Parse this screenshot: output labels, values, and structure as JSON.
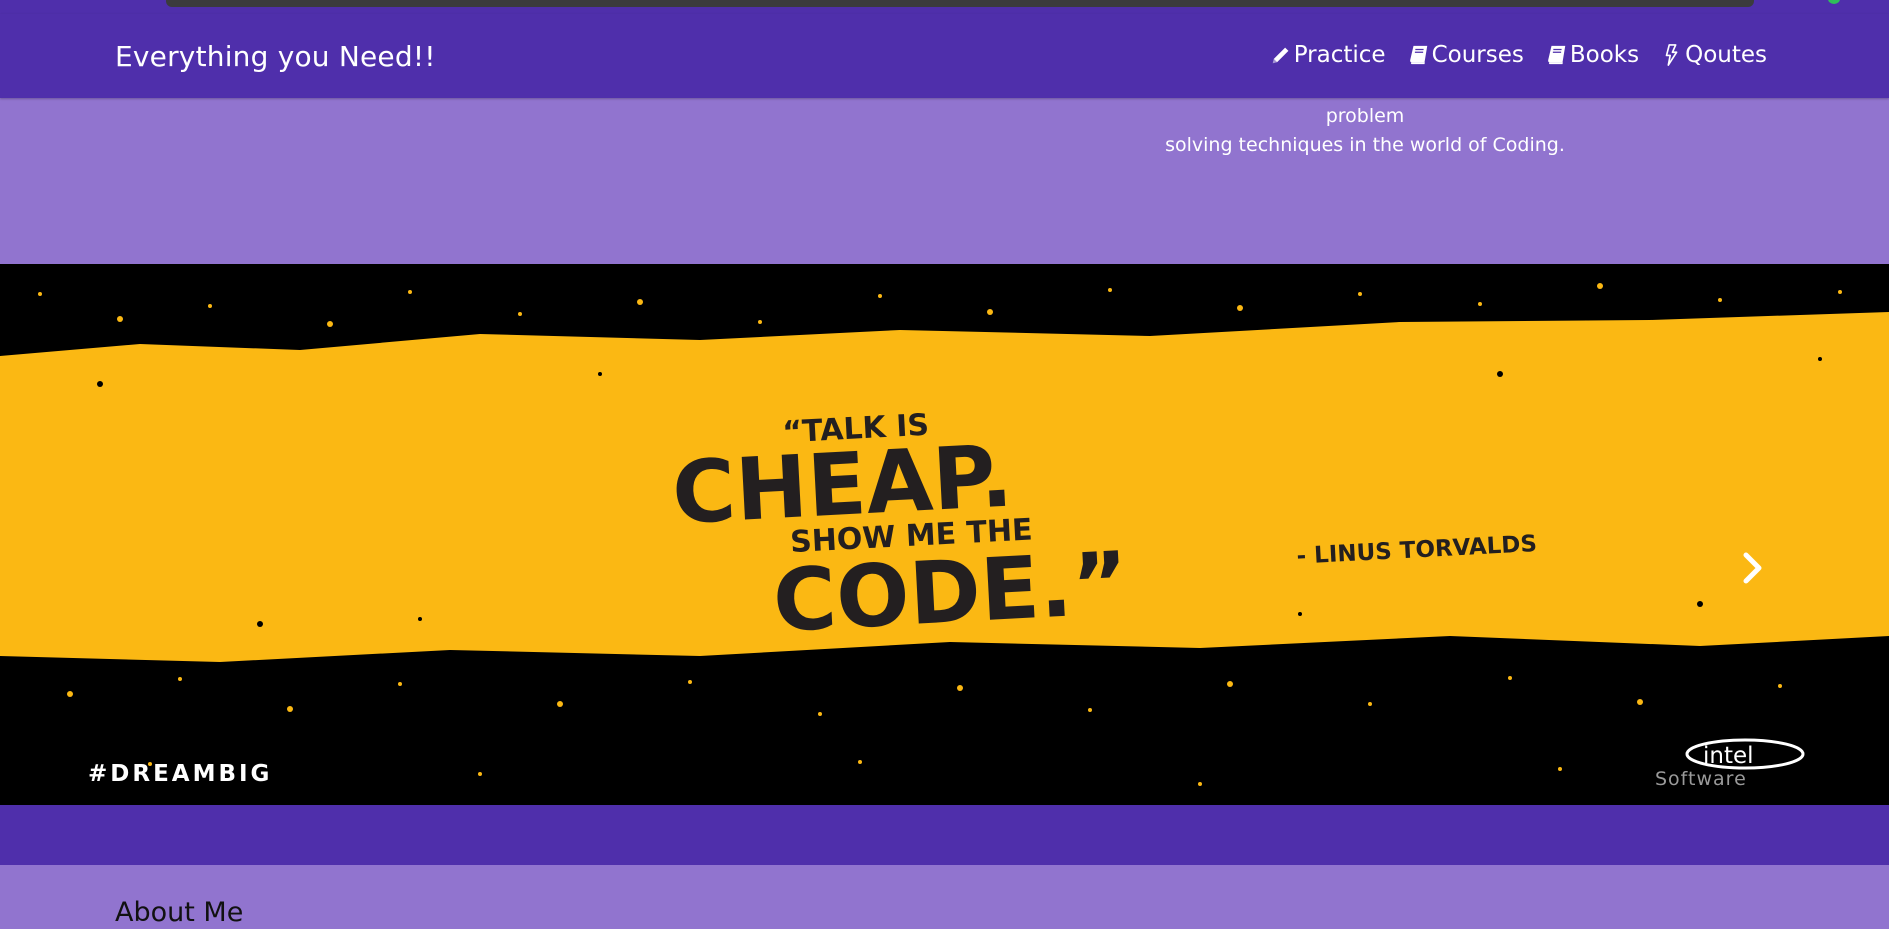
{
  "navbar": {
    "brand": "Everything you Need!!",
    "links": [
      {
        "label": "Practice",
        "icon": "pencil-icon"
      },
      {
        "label": "Courses",
        "icon": "book-icon"
      },
      {
        "label": "Books",
        "icon": "book-icon"
      },
      {
        "label": "Qoutes",
        "icon": "bolt-icon"
      }
    ]
  },
  "intro": {
    "line1": "In the practice place , you will find the resources for practising questions and problem",
    "line2": "solving techniques in the world of Coding."
  },
  "carousel": {
    "slide": {
      "quote_open": "“TALK IS",
      "big1": "CHEAP.",
      "mid": "SHOW ME THE",
      "big2": "CODE.”",
      "author": "- LINUS TORVALDS",
      "hashtag": "#DREAMBIG",
      "logo": "intel",
      "logo_sub": "Software"
    },
    "prev_icon": "chevron-left-icon",
    "next_icon": "chevron-right-icon"
  },
  "about": {
    "title": "About Me"
  },
  "colors": {
    "navbar": "#4f2fab",
    "page": "#9174cf",
    "banner_yellow": "#fbb813"
  }
}
